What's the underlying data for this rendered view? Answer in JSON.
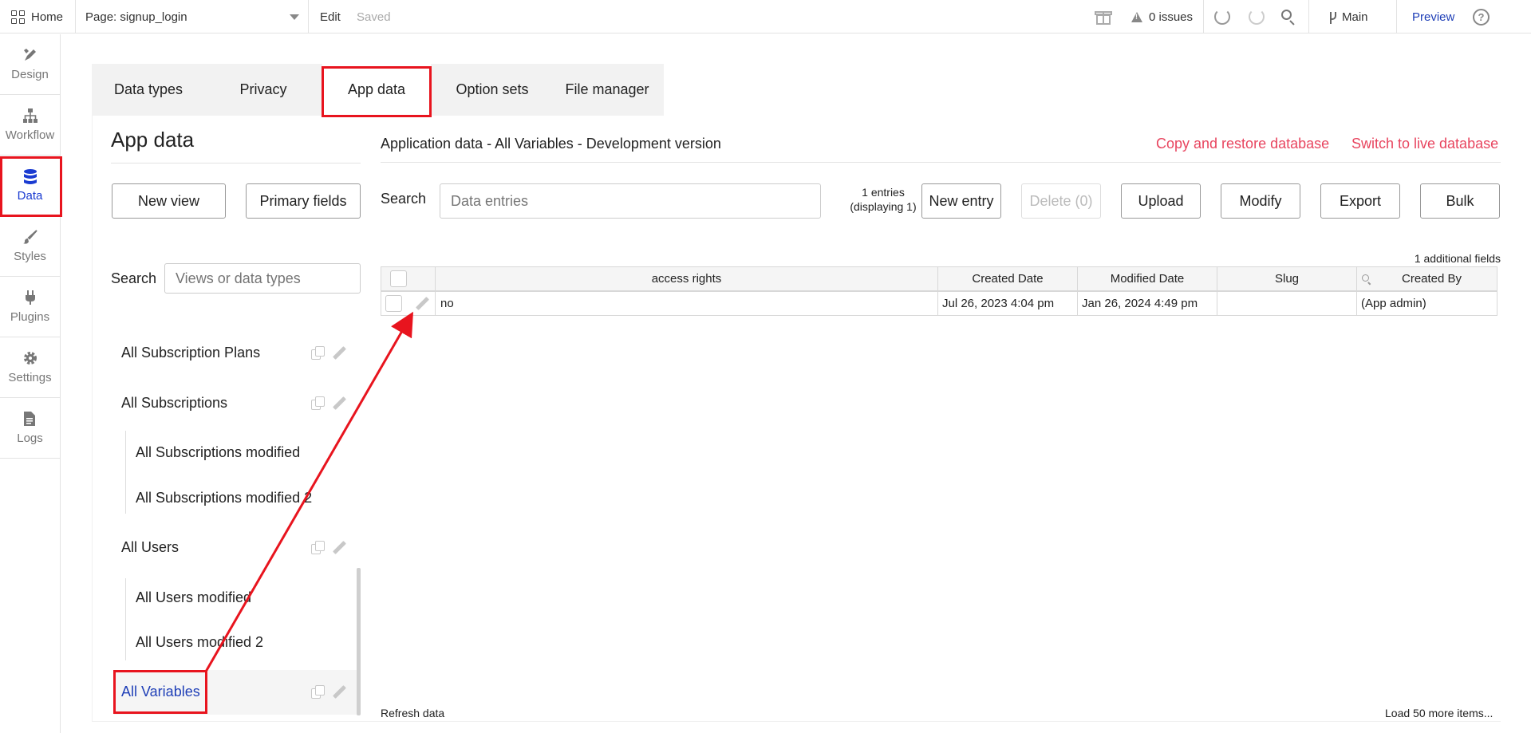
{
  "topbar": {
    "home_label": "Home",
    "page_select": "Page: signup_login",
    "edit_label": "Edit",
    "saved_label": "Saved",
    "issues_label": "0 issues",
    "branch_label": "Main",
    "preview_label": "Preview",
    "help_glyph": "?"
  },
  "rail": {
    "items": [
      {
        "label": "Design",
        "icon": "design-icon"
      },
      {
        "label": "Workflow",
        "icon": "workflow-icon"
      },
      {
        "label": "Data",
        "icon": "database-icon"
      },
      {
        "label": "Styles",
        "icon": "brush-icon"
      },
      {
        "label": "Plugins",
        "icon": "plug-icon"
      },
      {
        "label": "Settings",
        "icon": "gear-icon"
      },
      {
        "label": "Logs",
        "icon": "document-icon"
      }
    ],
    "active": "Data"
  },
  "tabs": [
    {
      "label": "Data types"
    },
    {
      "label": "Privacy"
    },
    {
      "label": "App data"
    },
    {
      "label": "Option sets"
    },
    {
      "label": "File manager"
    }
  ],
  "left_panel": {
    "title": "App data",
    "new_view_button": "New view",
    "primary_fields_button": "Primary fields",
    "search_label": "Search",
    "search_placeholder": "Views or data types",
    "views": [
      {
        "label": "All Subscription Plans"
      },
      {
        "label": "All Subscriptions"
      },
      {
        "label": "All Subscriptions modified"
      },
      {
        "label": "All Subscriptions modified 2"
      },
      {
        "label": "All Users"
      },
      {
        "label": "All Users modified"
      },
      {
        "label": "All Users modified 2"
      },
      {
        "label": "All Variables"
      }
    ]
  },
  "main": {
    "header": "Application data - All Variables - Development version",
    "copy_restore_link": "Copy and restore database",
    "switch_live_link": "Switch to live database",
    "search_label": "Search",
    "search_placeholder": "Data entries",
    "entries_info": "1 entries (displaying 1)",
    "buttons": {
      "new_entry": "New entry",
      "delete": "Delete (0)",
      "upload": "Upload",
      "modify": "Modify",
      "export": "Export",
      "bulk": "Bulk"
    },
    "additional_fields": "1 additional fields",
    "table": {
      "columns": [
        "access rights",
        "Created Date",
        "Modified Date",
        "Slug",
        "Created By"
      ],
      "rows": [
        {
          "access_rights": "no",
          "created_date": "Jul 26, 2023 4:04 pm",
          "modified_date": "Jan 26, 2024 4:49 pm",
          "slug": "",
          "created_by": "(App admin)"
        }
      ]
    },
    "refresh_label": "Refresh data",
    "load_more_label": "Load 50 more items..."
  },
  "colors": {
    "accent_blue": "#1f3fb7",
    "link_red": "#e8455f",
    "annotation_red": "#e8141e"
  }
}
